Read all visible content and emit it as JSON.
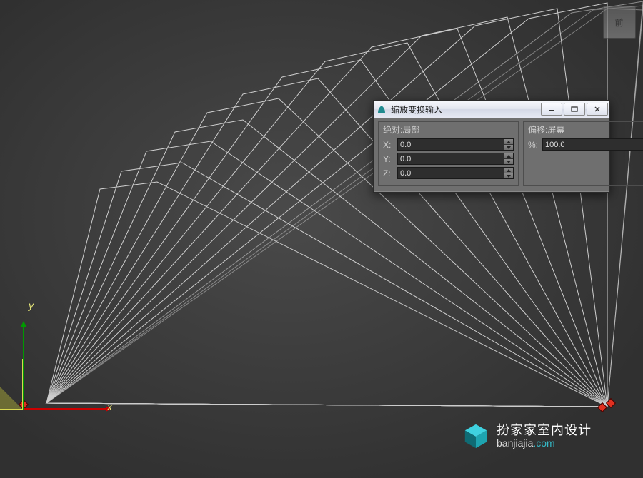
{
  "viewcube": {
    "face_label": "前"
  },
  "axes": {
    "x_label": "x",
    "y_label": "y"
  },
  "dialog": {
    "title": "缩放变换输入",
    "group_absolute": {
      "title": "绝对:局部",
      "x_label": "X:",
      "y_label": "Y:",
      "z_label": "Z:",
      "x_value": "0.0",
      "y_value": "0.0",
      "z_value": "0.0"
    },
    "group_offset": {
      "title": "偏移:屏幕",
      "percent_label": "%:",
      "percent_value": "100.0"
    }
  },
  "watermark": {
    "title": "扮家家室内设计",
    "sub_prefix": "banjiajia",
    "sub_suffix": ".com"
  }
}
